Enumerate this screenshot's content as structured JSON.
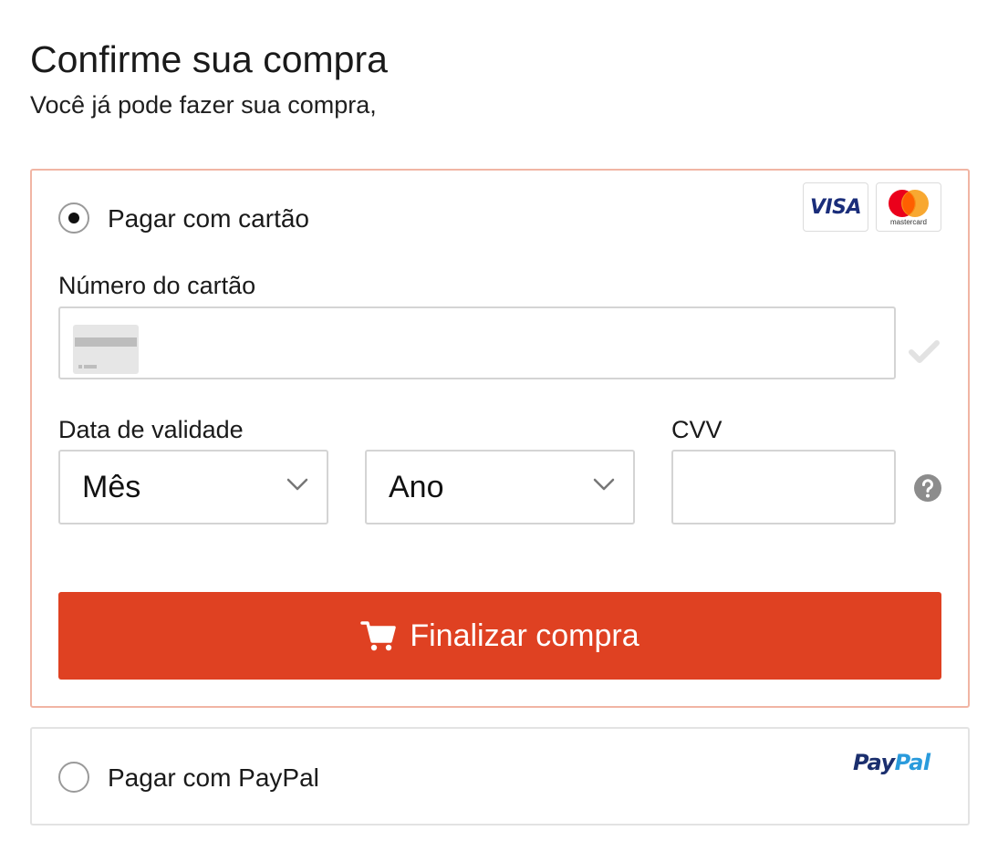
{
  "header": {
    "title": "Confirme sua compra",
    "subtitle": "Você já pode fazer sua compra,"
  },
  "card_option": {
    "label": "Pagar com cartão",
    "selected": true,
    "brands": [
      {
        "name": "VISA",
        "icon": "visa-logo"
      },
      {
        "name": "mastercard",
        "icon": "mastercard-logo"
      }
    ],
    "card_number": {
      "label": "Número do cartão",
      "value": "",
      "icon": "credit-card-icon",
      "status_icon": "checkmark-icon"
    },
    "expiry": {
      "label": "Data de validade",
      "month": {
        "selected": "Mês"
      },
      "year": {
        "selected": "Ano"
      }
    },
    "cvv": {
      "label": "CVV",
      "value": "",
      "help_icon": "question-circle-icon"
    },
    "submit": {
      "label": "Finalizar compra",
      "icon": "cart-icon",
      "color": "#df4122"
    }
  },
  "paypal_option": {
    "label": "Pagar com PayPal",
    "selected": false,
    "logo": {
      "pay": "Pay",
      "pal": "Pal"
    }
  },
  "colors": {
    "accent": "#df4122",
    "selected_border": "#f1b5a4",
    "visa_blue": "#1a2d7a",
    "mastercard_red": "#eb001b",
    "mastercard_orange": "#f79e1b",
    "paypal_dark": "#1b2f6e",
    "paypal_light": "#2a9bdc"
  }
}
